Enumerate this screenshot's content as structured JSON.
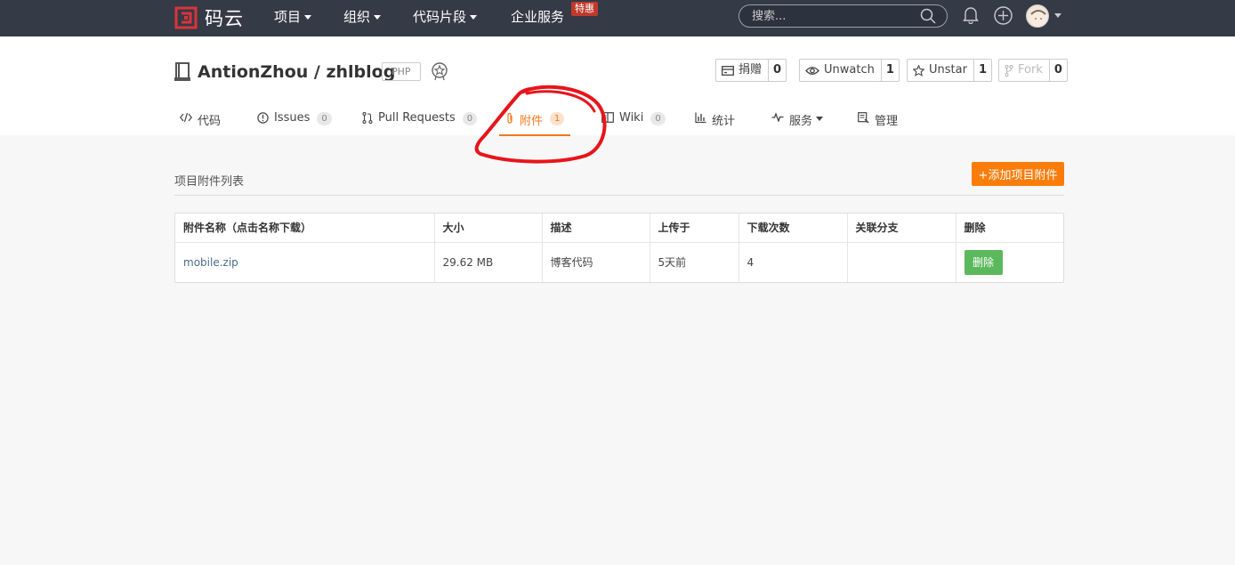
{
  "topnav": {
    "logo_text": "码云",
    "items": [
      {
        "label": "项目"
      },
      {
        "label": "组织"
      },
      {
        "label": "代码片段"
      },
      {
        "label": "企业服务"
      }
    ],
    "special_badge": "特惠",
    "search_placeholder": "搜索..."
  },
  "repo": {
    "title": "AntionZhou / zhlblog",
    "language": "PHP",
    "actions": [
      {
        "label": "捐赠",
        "count": "0"
      },
      {
        "label": "Unwatch",
        "count": "1"
      },
      {
        "label": "Unstar",
        "count": "1"
      },
      {
        "label": "Fork",
        "count": "0"
      }
    ]
  },
  "tabs": [
    {
      "label": "代码"
    },
    {
      "label": "Issues",
      "count": "0"
    },
    {
      "label": "Pull Requests",
      "count": "0"
    },
    {
      "label": "附件",
      "count": "1"
    },
    {
      "label": "Wiki",
      "count": "0"
    },
    {
      "label": "统计"
    },
    {
      "label": "服务"
    },
    {
      "label": "管理"
    }
  ],
  "attachments": {
    "section_title": "项目附件列表",
    "add_button": "+添加项目附件",
    "columns": [
      "附件名称（点击名称下载）",
      "大小",
      "描述",
      "上传于",
      "下载次数",
      "关联分支",
      "删除"
    ],
    "rows": [
      {
        "name": "mobile.zip",
        "size": "29.62 MB",
        "description": "博客代码",
        "uploaded": "5天前",
        "downloads": "4",
        "branch": "",
        "delete_label": "删除"
      }
    ]
  },
  "colors": {
    "topbar": "#343a46",
    "accent": "#f0781e",
    "add_button": "#fa7d0b",
    "delete_button": "#5cb85c",
    "annotation": "#e8141b"
  },
  "icons": [
    "logo-icon",
    "search-icon",
    "bell-icon",
    "plus-circle-icon",
    "repo-book-icon",
    "award-icon",
    "donate-icon",
    "eye-icon",
    "star-icon",
    "fork-icon",
    "code-icon",
    "issue-icon",
    "pull-request-icon",
    "paperclip-icon",
    "wiki-icon",
    "chart-icon",
    "pulse-icon",
    "settings-icon"
  ]
}
